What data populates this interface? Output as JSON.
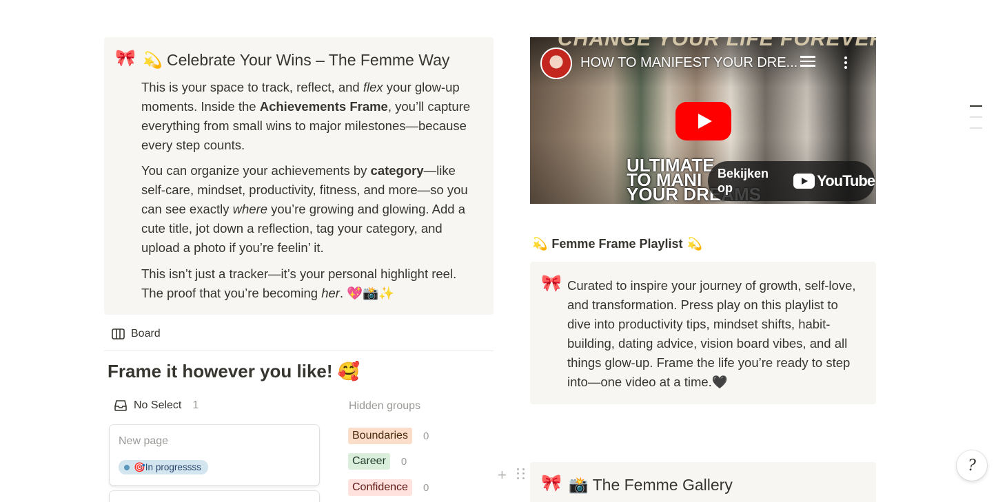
{
  "wins_callout": {
    "icon": "🎀",
    "title": "💫 Celebrate Your Wins – The Femme Way",
    "p1": {
      "a": "This is your space to track, reflect, and ",
      "b": "flex",
      "c": " your glow-up moments. Inside the ",
      "d": "Achievements Frame",
      "e": ", you’ll capture everything from small wins to major milestones—because every step counts."
    },
    "p2": {
      "a": "You can organize your achievements by ",
      "b": "category",
      "c": "—like self-care, mindset, productivity, fitness, and more—so you can see exactly ",
      "d": "where",
      "e": " you’re growing and glowing. Add a cute title, jot down a reflection, tag your category, and upload a photo if you’re feelin’ it."
    },
    "p3": {
      "a": "This isn’t just a tracker—it’s your personal highlight reel. The proof that you’re becoming ",
      "b": "her",
      "c": ". 💖📸✨"
    }
  },
  "board": {
    "tab_icon": "board-view-icon",
    "tab_label": "Board",
    "title": "Frame it however you like! 🥰",
    "group": {
      "icon": "inbox-icon",
      "label": "No Select",
      "count": "1",
      "cards": [
        {
          "title": "New page",
          "tag": "🎯In progressss"
        }
      ]
    },
    "hidden_groups": {
      "label": "Hidden groups",
      "items": [
        {
          "label": "Boundaries",
          "count": "0"
        },
        {
          "label": "Career",
          "count": "0"
        },
        {
          "label": "Confidence",
          "count": "0"
        }
      ]
    }
  },
  "video": {
    "banner": "CHANGE YOUR LIFE FOREVER!",
    "title": "HOW TO MANIFEST YOUR DRE...",
    "overlay": "ULTIMATE\nTO MANI\nYOUR DREAMS",
    "watch_label": "Bekijken op",
    "brand": "YouTube"
  },
  "playlist": {
    "heading_left": "💫",
    "heading": "Femme Frame Playlist",
    "heading_right": "💫",
    "icon": "🎀",
    "text": "Curated to inspire your journey of growth, self-love, and transformation. Press play on this playlist to dive into productivity tips, mindset shifts, habit-building, dating advice, vision board vibes, and all things glow-up. Frame the life you’re ready to step into—one video at a time.🖤"
  },
  "gallery": {
    "icon": "🎀",
    "title": "📸 The Femme Gallery"
  },
  "help": {
    "glyph": "?"
  },
  "colors": {
    "callout_bg": "#f7f6f3",
    "tag_blue": "#d3e5ef",
    "tag_orange": "#fadec9",
    "tag_green": "#dbeddb",
    "tag_red": "#ffe2dd",
    "play_red": "#ff0000"
  }
}
